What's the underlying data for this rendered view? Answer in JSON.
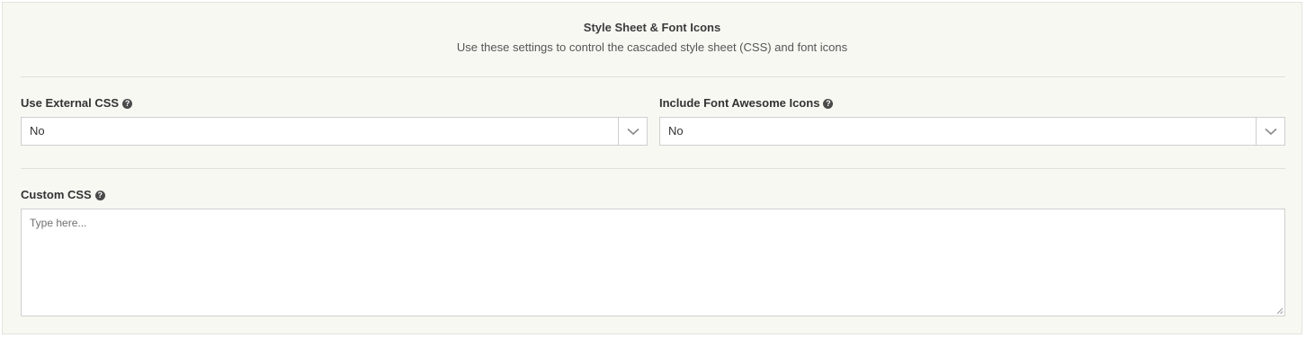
{
  "section": {
    "title": "Style Sheet & Font Icons",
    "subtitle": "Use these settings to control the cascaded style sheet (CSS) and font icons"
  },
  "fields": {
    "external_css": {
      "label": "Use External CSS",
      "value": "No",
      "help_icon": "question-circle-icon"
    },
    "font_awesome": {
      "label": "Include Font Awesome Icons",
      "value": "No",
      "help_icon": "question-circle-icon"
    },
    "custom_css": {
      "label": "Custom CSS",
      "placeholder": "Type here...",
      "value": "",
      "help_icon": "question-circle-icon"
    }
  },
  "icons": {
    "dropdown": "chevron-down-icon",
    "help": "question-circle-icon",
    "resize": "resize-handle-icon"
  },
  "colors": {
    "panel_background": "#f8f8f3",
    "border": "#cfcfcf",
    "text": "#333333"
  }
}
